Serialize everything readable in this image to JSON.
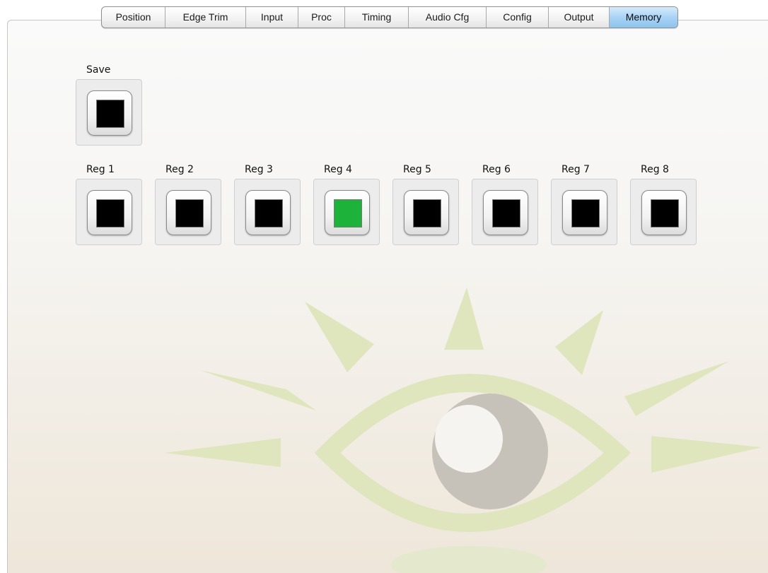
{
  "tabs": [
    {
      "label": "Position"
    },
    {
      "label": "Edge Trim"
    },
    {
      "label": "Input"
    },
    {
      "label": "Proc"
    },
    {
      "label": "Timing"
    },
    {
      "label": "Audio Cfg"
    },
    {
      "label": "Config"
    },
    {
      "label": "Output"
    },
    {
      "label": "Memory"
    }
  ],
  "selected_tab": "Memory",
  "save": {
    "label": "Save",
    "indicator_color": "#000000"
  },
  "registers": [
    {
      "label": "Reg 1",
      "indicator_color": "#000000"
    },
    {
      "label": "Reg 2",
      "indicator_color": "#000000"
    },
    {
      "label": "Reg 3",
      "indicator_color": "#000000"
    },
    {
      "label": "Reg 4",
      "indicator_color": "#1db33a"
    },
    {
      "label": "Reg 5",
      "indicator_color": "#000000"
    },
    {
      "label": "Reg 6",
      "indicator_color": "#000000"
    },
    {
      "label": "Reg 7",
      "indicator_color": "#000000"
    },
    {
      "label": "Reg 8",
      "indicator_color": "#000000"
    }
  ],
  "colors": {
    "watermark_rays": "#dfe5bd",
    "watermark_iris": "#c7c2b9",
    "selected_tab": "#a9d3f5"
  },
  "watermark": {
    "icon": "eye-logo"
  }
}
